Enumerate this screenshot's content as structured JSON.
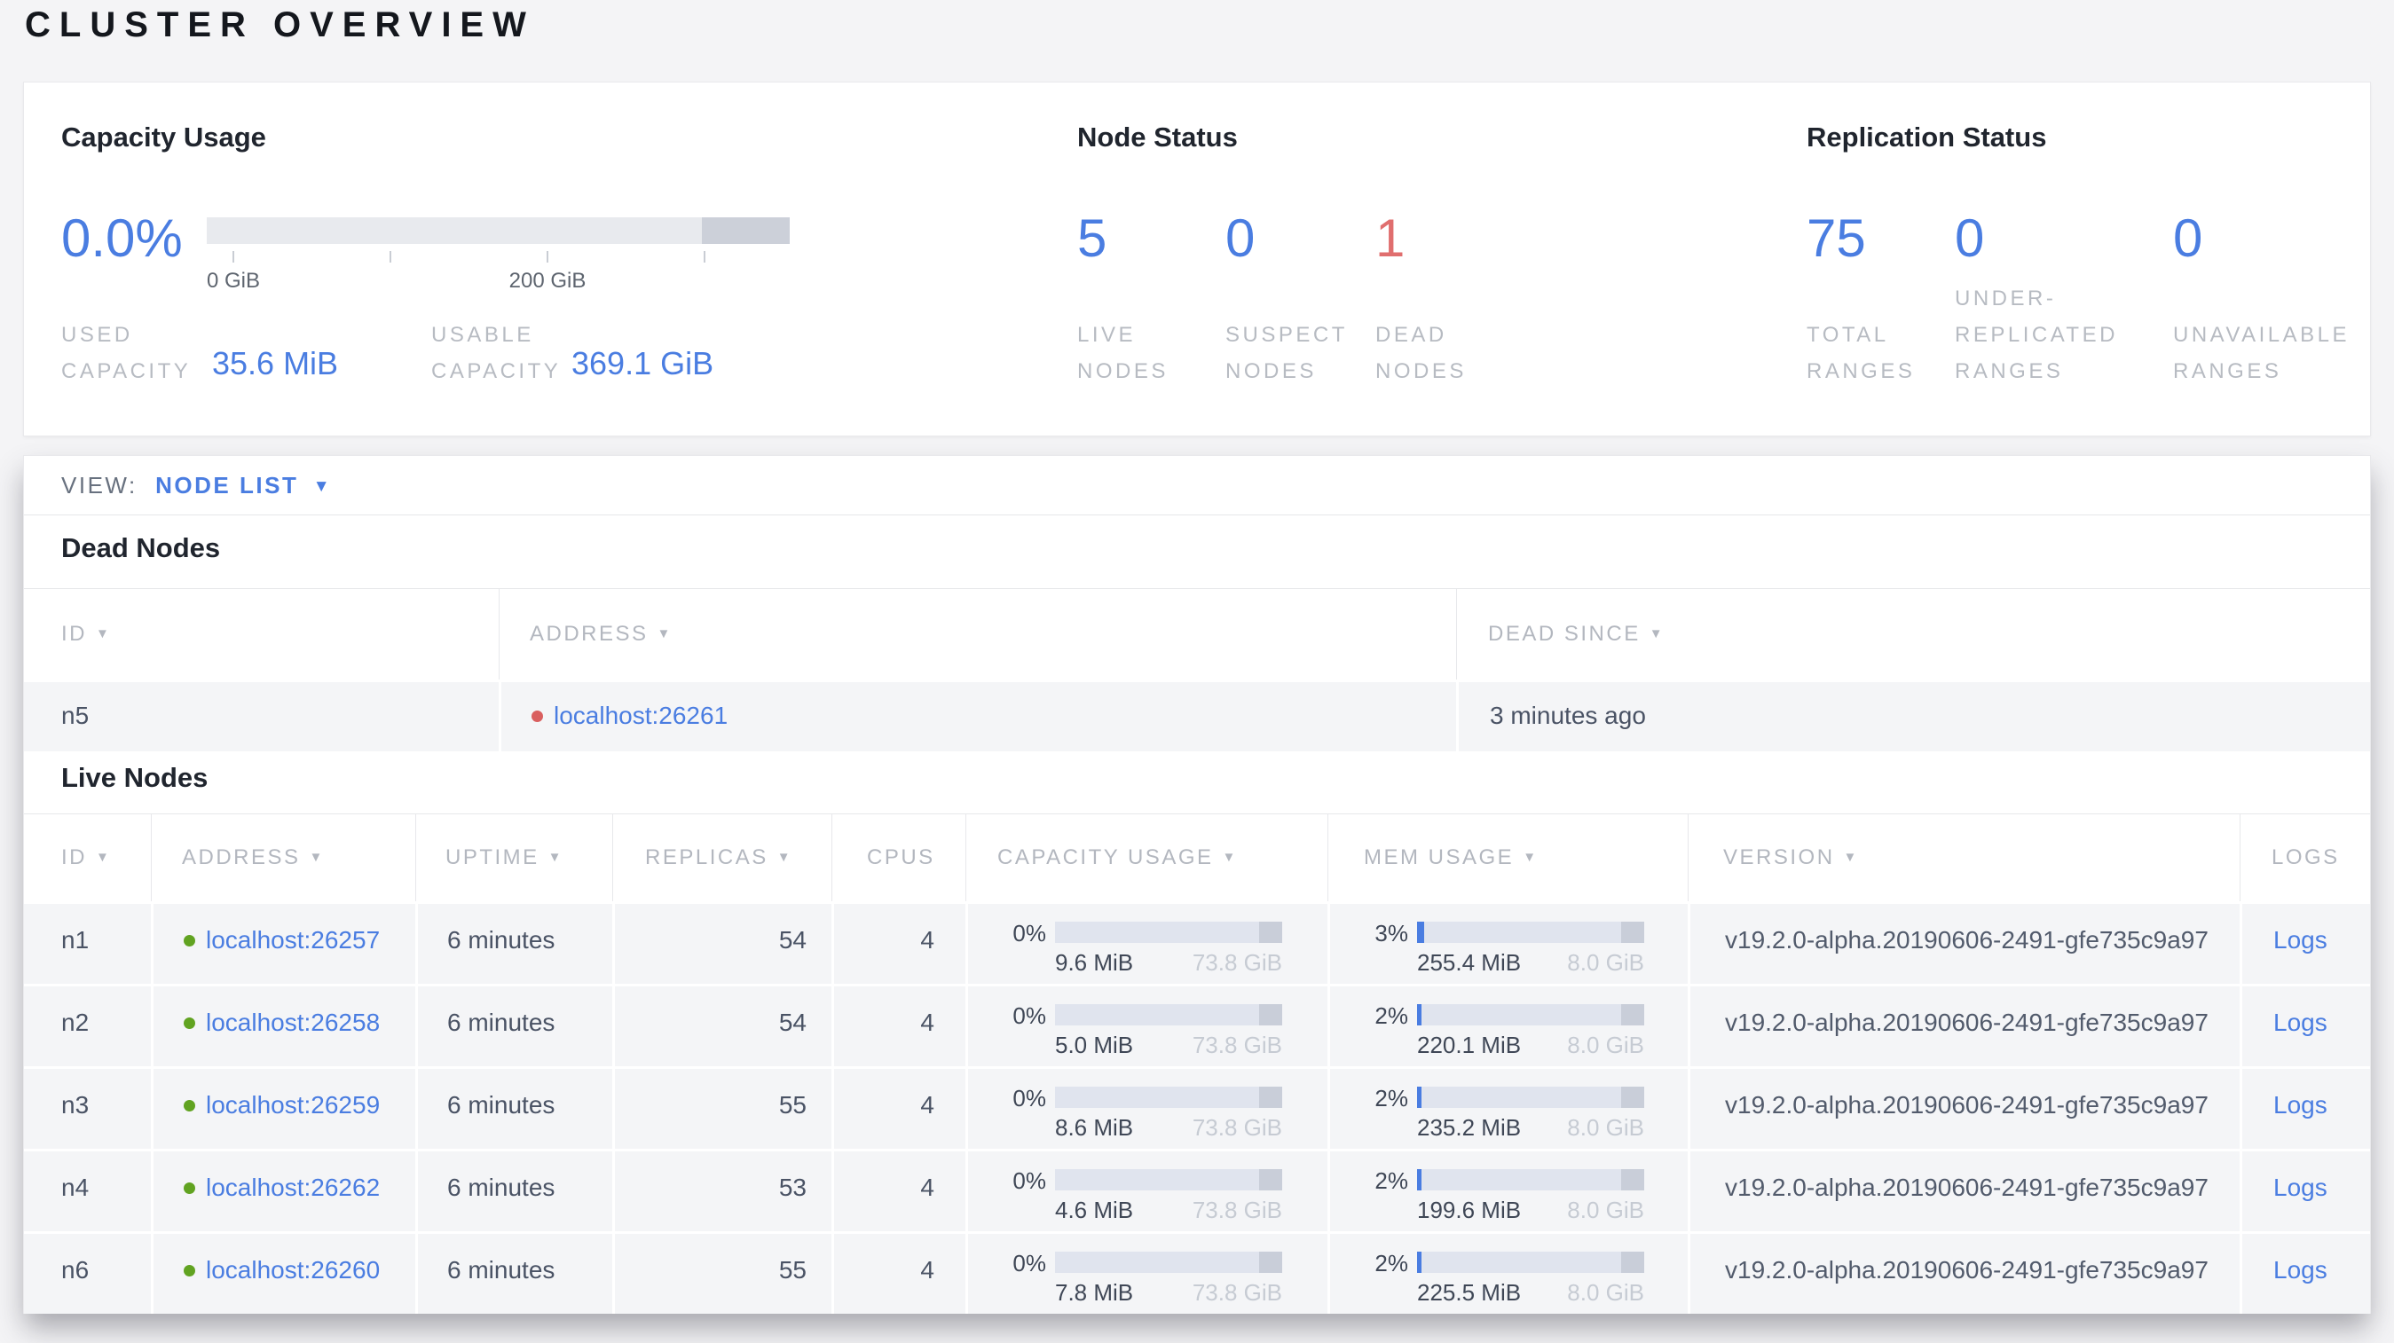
{
  "colors": {
    "accent_blue": "#4a7de1",
    "danger_red": "#e06e6e",
    "live_green": "#61a321",
    "bar_track": "#e0e4ee",
    "bar_reserved": "#c9ced9"
  },
  "page": {
    "title": "CLUSTER OVERVIEW"
  },
  "summary": {
    "capacity": {
      "title": "Capacity Usage",
      "percent": "0.0%",
      "fill_percent": "0%",
      "tick_labels": {
        "zero": "0 GiB",
        "twohundred": "200 GiB"
      },
      "used": {
        "label": "USED\nCAPACITY",
        "value": "35.6 MiB"
      },
      "usable": {
        "label": "USABLE\nCAPACITY",
        "value": "369.1 GiB"
      }
    },
    "node_status": {
      "title": "Node Status",
      "stats": [
        {
          "value": "5",
          "label": "LIVE\nNODES"
        },
        {
          "value": "0",
          "label": "SUSPECT\nNODES"
        },
        {
          "value": "1",
          "label": "DEAD\nNODES"
        }
      ]
    },
    "replication": {
      "title": "Replication Status",
      "stats": [
        {
          "value": "75",
          "label": "TOTAL\nRANGES"
        },
        {
          "value": "0",
          "label": "UNDER-\nREPLICATED\nRANGES"
        },
        {
          "value": "0",
          "label": "UNAVAILABLE\nRANGES"
        }
      ]
    }
  },
  "view_bar": {
    "label": "VIEW:",
    "selected": "NODE LIST",
    "caret": "▼"
  },
  "dead_nodes": {
    "title": "Dead Nodes",
    "columns": {
      "id": "ID",
      "address": "ADDRESS",
      "dead_since": "DEAD SINCE"
    },
    "sort_arrow": "▼",
    "rows": [
      {
        "id": "n5",
        "address": "localhost:26261",
        "dead_since": "3 minutes ago"
      }
    ]
  },
  "live_nodes": {
    "title": "Live Nodes",
    "columns": {
      "id": "ID",
      "address": "ADDRESS",
      "uptime": "UPTIME",
      "replicas": "REPLICAS",
      "cpus": "CPUS",
      "capacity": "CAPACITY USAGE",
      "mem": "MEM USAGE",
      "version": "VERSION",
      "logs": "LOGS"
    },
    "sort_arrow": "▼",
    "rows": [
      {
        "id": "n1",
        "address": "localhost:26257",
        "uptime": "6 minutes",
        "replicas": "54",
        "cpus": "4",
        "capacity": {
          "percent": "0%",
          "used": "9.6 MiB",
          "total": "73.8 GiB"
        },
        "mem": {
          "percent": "3%",
          "used": "255.4 MiB",
          "total": "8.0 GiB"
        },
        "version": "v19.2.0-alpha.20190606-2491-gfe735c9a97",
        "logs": "Logs"
      },
      {
        "id": "n2",
        "address": "localhost:26258",
        "uptime": "6 minutes",
        "replicas": "54",
        "cpus": "4",
        "capacity": {
          "percent": "0%",
          "used": "5.0 MiB",
          "total": "73.8 GiB"
        },
        "mem": {
          "percent": "2%",
          "used": "220.1 MiB",
          "total": "8.0 GiB"
        },
        "version": "v19.2.0-alpha.20190606-2491-gfe735c9a97",
        "logs": "Logs"
      },
      {
        "id": "n3",
        "address": "localhost:26259",
        "uptime": "6 minutes",
        "replicas": "55",
        "cpus": "4",
        "capacity": {
          "percent": "0%",
          "used": "8.6 MiB",
          "total": "73.8 GiB"
        },
        "mem": {
          "percent": "2%",
          "used": "235.2 MiB",
          "total": "8.0 GiB"
        },
        "version": "v19.2.0-alpha.20190606-2491-gfe735c9a97",
        "logs": "Logs"
      },
      {
        "id": "n4",
        "address": "localhost:26262",
        "uptime": "6 minutes",
        "replicas": "53",
        "cpus": "4",
        "capacity": {
          "percent": "0%",
          "used": "4.6 MiB",
          "total": "73.8 GiB"
        },
        "mem": {
          "percent": "2%",
          "used": "199.6 MiB",
          "total": "8.0 GiB"
        },
        "version": "v19.2.0-alpha.20190606-2491-gfe735c9a97",
        "logs": "Logs"
      },
      {
        "id": "n6",
        "address": "localhost:26260",
        "uptime": "6 minutes",
        "replicas": "55",
        "cpus": "4",
        "capacity": {
          "percent": "0%",
          "used": "7.8 MiB",
          "total": "73.8 GiB"
        },
        "mem": {
          "percent": "2%",
          "used": "225.5 MiB",
          "total": "8.0 GiB"
        },
        "version": "v19.2.0-alpha.20190606-2491-gfe735c9a97",
        "logs": "Logs"
      }
    ]
  }
}
